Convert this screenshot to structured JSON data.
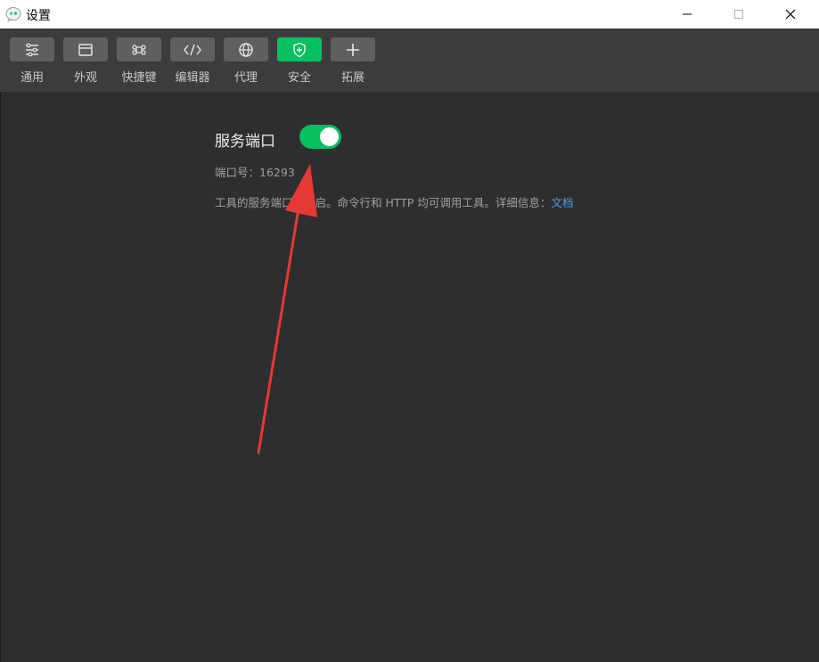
{
  "window": {
    "title": "设置",
    "minimize_glyph": "—",
    "maximize_glyph": "☐",
    "close_glyph": "✕"
  },
  "toolbar": {
    "items": [
      {
        "label": "通用",
        "icon": "sliders-icon"
      },
      {
        "label": "外观",
        "icon": "window-icon"
      },
      {
        "label": "快捷键",
        "icon": "command-key-icon"
      },
      {
        "label": "编辑器",
        "icon": "code-icon"
      },
      {
        "label": "代理",
        "icon": "globe-icon"
      },
      {
        "label": "安全",
        "icon": "shield-icon",
        "active": true
      },
      {
        "label": "拓展",
        "icon": "plus-icon"
      }
    ]
  },
  "service_port": {
    "title": "服务端口",
    "enabled": true,
    "port_label": "端口号：",
    "port_value": "16293",
    "description": "工具的服务端口已开启。命令行和 HTTP 均可调用工具。详细信息：",
    "doc_link": "文档"
  },
  "colors": {
    "accent": "#07c160",
    "toolbar_bg": "#3c3c3c",
    "content_bg": "#2e2e2e",
    "link": "#4b9bea",
    "annotation_arrow": "#e53935"
  }
}
